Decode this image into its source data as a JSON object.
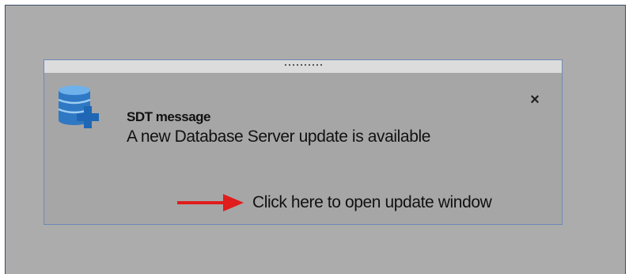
{
  "notification": {
    "title": "SDT message",
    "message": "A new Database Server update is available",
    "link_label": "Click here to open update window",
    "close_glyph": "×"
  },
  "icons": {
    "app": "database-add-icon",
    "close": "close-icon",
    "pointer": "red-arrow-icon",
    "grip": "drag-grip-icon"
  },
  "colors": {
    "background": "#acacac",
    "toast_border": "#6f88b8",
    "arrow": "#e01c1c",
    "database_blue": "#2f78c4"
  }
}
